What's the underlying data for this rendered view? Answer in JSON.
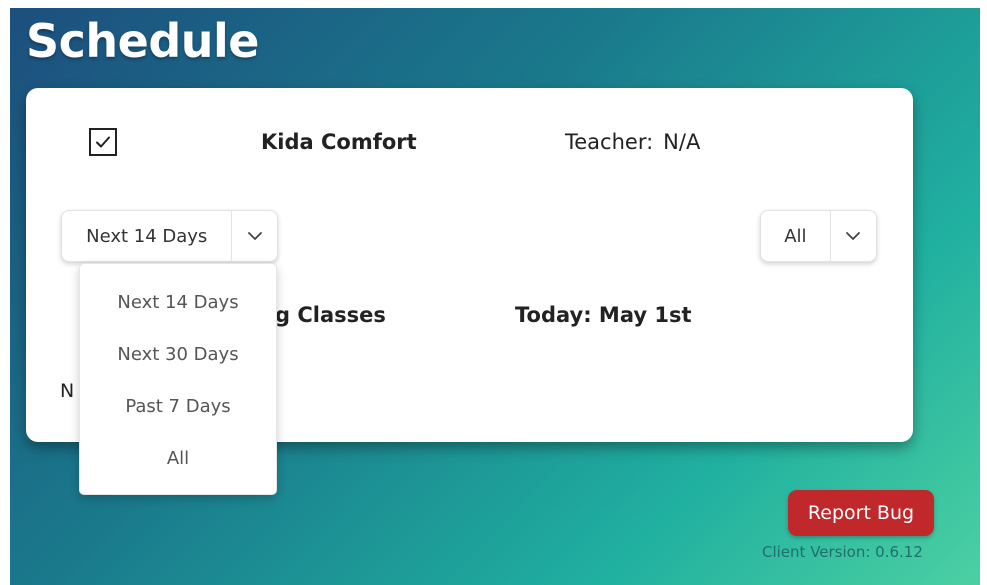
{
  "header": {
    "title": "Schedule"
  },
  "student": {
    "checked": true,
    "name": "Kida Comfort",
    "teacher_label": "Teacher:",
    "teacher_value": "N/A"
  },
  "filters": {
    "range": {
      "selected": "Next 14 Days",
      "options": [
        "Next 14 Days",
        "Next 30 Days",
        "Past 7 Days",
        "All"
      ]
    },
    "type": {
      "selected": "All"
    }
  },
  "classes": {
    "heading_visible": "g Classes",
    "today": "Today: May 1st",
    "empty_message_visible": "N"
  },
  "footer": {
    "report_bug_label": "Report Bug",
    "client_version": "Client Version: 0.6.12"
  },
  "colors": {
    "report_bug": "#c0282b",
    "gradient_start": "#1c4f7e",
    "gradient_end": "#4cd0a2"
  }
}
